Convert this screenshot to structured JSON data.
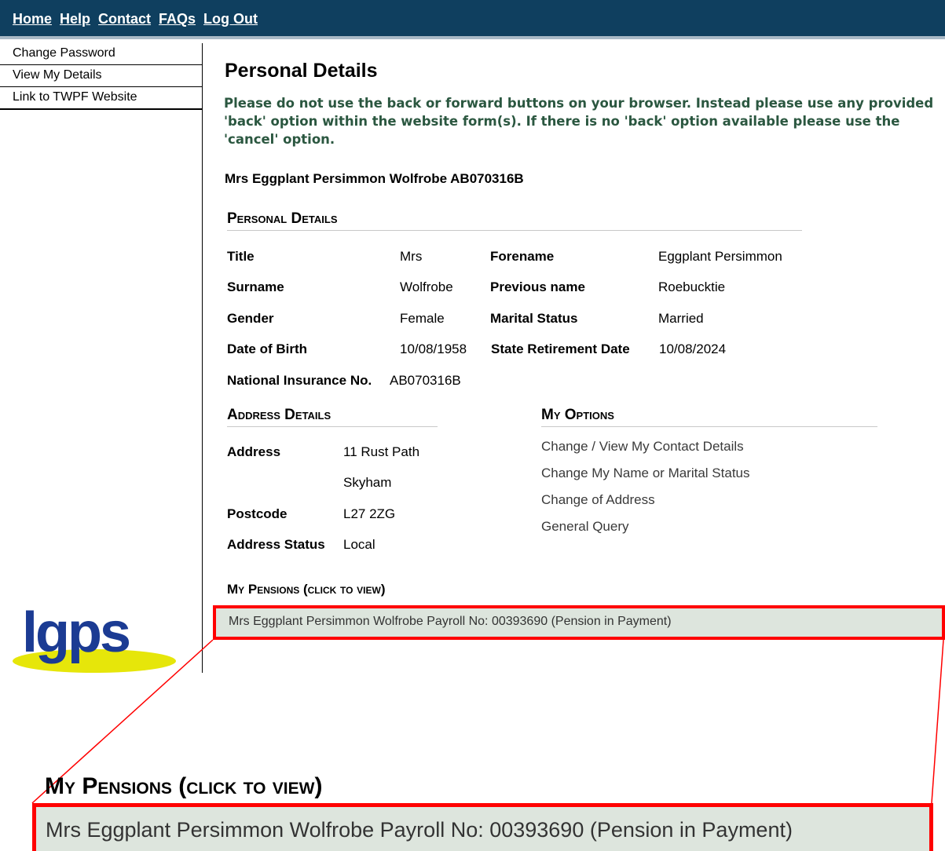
{
  "topnav": {
    "links": [
      "Home",
      "Help",
      "Contact",
      "FAQs",
      "Log Out"
    ]
  },
  "sidebar": {
    "items": [
      {
        "label": "Change Password"
      },
      {
        "label": "View My Details"
      },
      {
        "label": "Link to TWPF Website"
      }
    ],
    "logo_text": "lgps"
  },
  "page": {
    "title": "Personal Details",
    "warning": "Please do not use the back or forward buttons on your browser. Instead please use any provided 'back' option within the website form(s). If there is no 'back' option available please use the 'cancel' option.",
    "member_line": "Mrs Eggplant Persimmon Wolfrobe AB070316B"
  },
  "personal_details": {
    "heading": "Personal Details",
    "title_label": "Title",
    "title_value": "Mrs",
    "forename_label": "Forename",
    "forename_value": "Eggplant Persimmon",
    "surname_label": "Surname",
    "surname_value": "Wolfrobe",
    "previous_name_label": "Previous name",
    "previous_name_value": "Roebucktie",
    "gender_label": "Gender",
    "gender_value": "Female",
    "marital_status_label": "Marital Status",
    "marital_status_value": "Married",
    "dob_label": "Date of Birth",
    "dob_value": "10/08/1958",
    "retirement_label": "State Retirement Date",
    "retirement_value": "10/08/2024",
    "ni_label": "National Insurance No.",
    "ni_value": "AB070316B"
  },
  "address_details": {
    "heading": "Address Details",
    "address_label": "Address",
    "address_line1": "11 Rust Path",
    "address_line2": "Skyham",
    "postcode_label": "Postcode",
    "postcode_value": "L27 2ZG",
    "status_label": "Address Status",
    "status_value": "Local"
  },
  "my_options": {
    "heading": "My Options",
    "links": [
      "Change / View My Contact Details",
      "Change My Name or Marital Status",
      "Change of Address",
      "General Query"
    ]
  },
  "my_pensions": {
    "heading": "My Pensions (click to view)",
    "row_text": "Mrs Eggplant Persimmon Wolfrobe Payroll No: 00393690 (Pension in Payment)"
  },
  "colors": {
    "topbar": "#0f3f5f",
    "warning_text": "#2b5740",
    "pension_row_bg": "#dde5dd",
    "highlight": "#ff0000",
    "logo_blue": "#1b3b93",
    "logo_yellow": "#e6e60a"
  }
}
